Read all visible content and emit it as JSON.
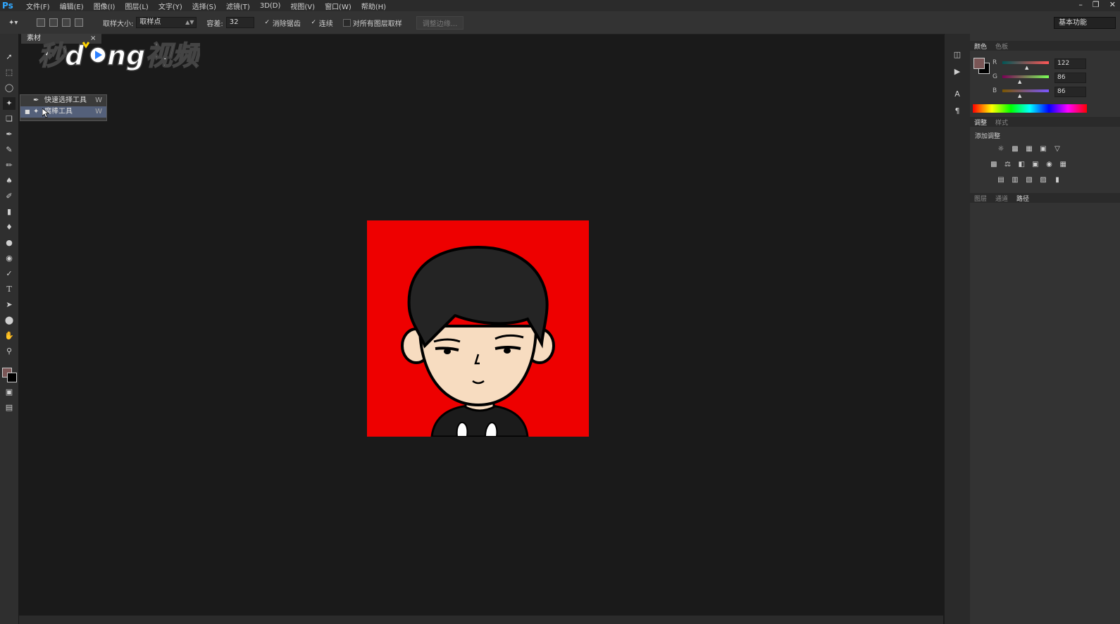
{
  "app": {
    "logo": "Ps"
  },
  "menu": [
    "文件(F)",
    "编辑(E)",
    "图像(I)",
    "图层(L)",
    "文字(Y)",
    "选择(S)",
    "滤镜(T)",
    "3D(D)",
    "视图(V)",
    "窗口(W)",
    "帮助(H)"
  ],
  "options_bar": {
    "sample_size_label": "取样大小:",
    "sample_size_value": "取样点",
    "tolerance_label": "容差:",
    "tolerance_value": "32",
    "antialias_label": "消除锯齿",
    "contiguous_label": "连续",
    "sample_all_label": "对所有图层取样",
    "refine_edge_label": "调整边缘...",
    "workspace": "基本功能"
  },
  "document": {
    "tab_label": "素材"
  },
  "watermark": {
    "text": "秒懂视频"
  },
  "tool_flyout": {
    "items": [
      {
        "label": "快速选择工具",
        "key": "W",
        "selected": false
      },
      {
        "label": "魔棒工具",
        "key": "W",
        "selected": true
      }
    ]
  },
  "color_panel": {
    "tabs": [
      "颜色",
      "色板"
    ],
    "foreground": "#7a5656",
    "r_label": "R",
    "r_value": "122",
    "g_label": "G",
    "g_value": "86",
    "b_label": "B",
    "b_value": "86"
  },
  "adjust_panel": {
    "tabs": [
      "调整",
      "样式"
    ],
    "title": "添加调整"
  },
  "layers_panel": {
    "tabs": [
      "图层",
      "通道",
      "路径"
    ]
  },
  "colors": {
    "canvas_bg": "#ee0000",
    "ui_dark": "#1a1a1a",
    "ui_panel": "#333333"
  }
}
